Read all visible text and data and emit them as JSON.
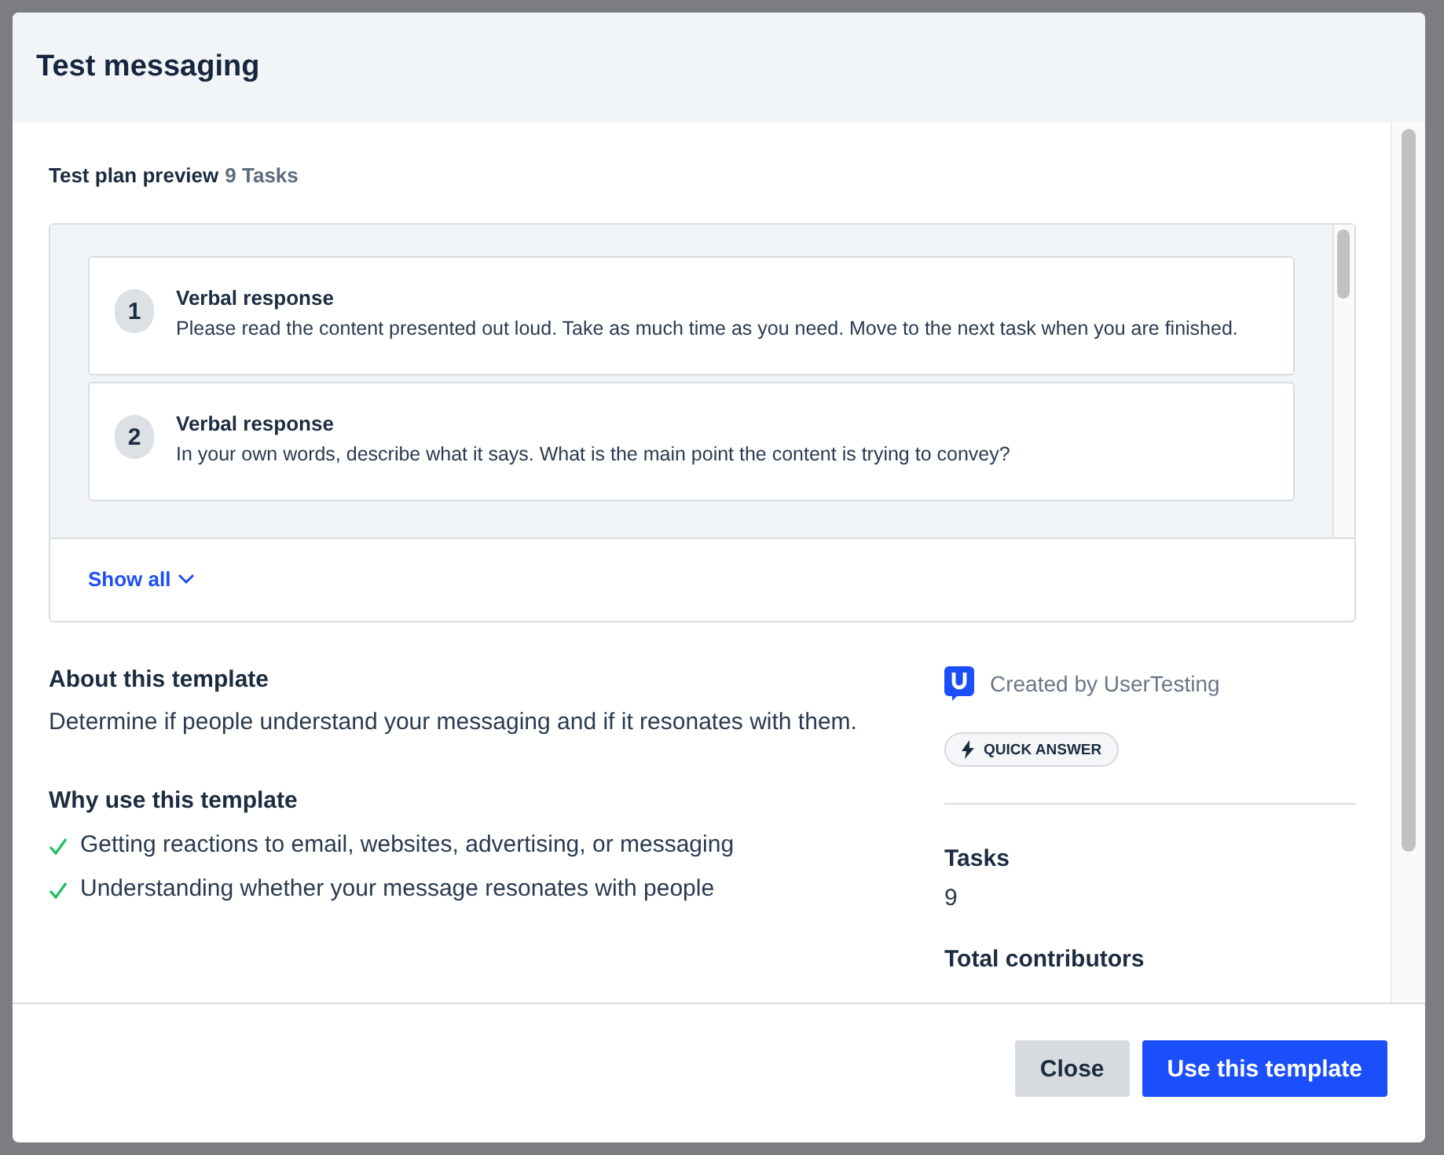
{
  "dialog": {
    "title": "Test messaging"
  },
  "test_plan": {
    "label": "Test plan preview",
    "count": "9 Tasks",
    "show_all": "Show all",
    "tasks": [
      {
        "number": "1",
        "type": "Verbal response",
        "text": "Please read the content presented out loud. Take as much time as you need. Move to the next task when you are finished."
      },
      {
        "number": "2",
        "type": "Verbal response",
        "text": "In your own words, describe what it says. What is the main point the content is trying to convey?"
      }
    ]
  },
  "about": {
    "heading": "About this template",
    "text": "Determine if people understand your messaging and if it resonates with them."
  },
  "why": {
    "heading": "Why use this template",
    "items": [
      "Getting reactions to email, websites, advertising, or messaging",
      "Understanding whether your message resonates with people"
    ]
  },
  "sidebar": {
    "creator": "Created by UserTesting",
    "badge": "QUICK ANSWER",
    "stats": [
      {
        "label": "Tasks",
        "value": "9"
      },
      {
        "label": "Total contributors"
      }
    ]
  },
  "buttons": [
    {
      "label": "Close",
      "kind": "secondary"
    },
    {
      "label": "Use this template",
      "kind": "primary"
    }
  ]
}
